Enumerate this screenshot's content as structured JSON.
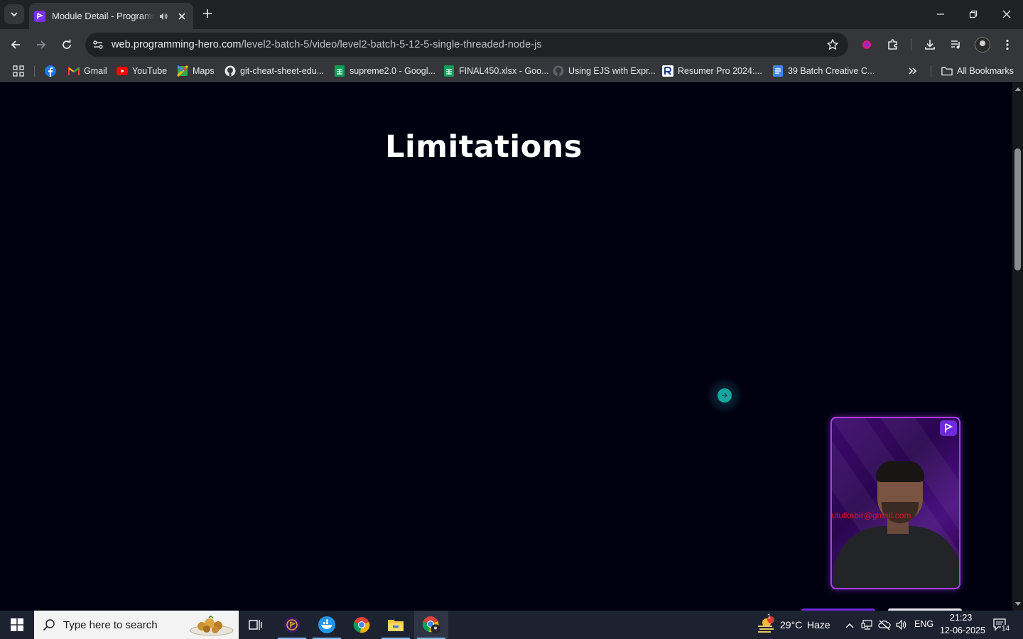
{
  "browser": {
    "tab": {
      "title": "Module Detail - Programming Hero"
    },
    "omnibox": {
      "host": "web.programming-hero.com",
      "path": "/level2-batch-5/video/level2-batch-5-12-5-single-threaded-node-js"
    },
    "bookmarks": [
      {
        "label": "",
        "icon": "facebook-icon"
      },
      {
        "label": "Gmail",
        "icon": "gmail-icon"
      },
      {
        "label": "YouTube",
        "icon": "youtube-icon"
      },
      {
        "label": "Maps",
        "icon": "maps-icon"
      },
      {
        "label": "git-cheat-sheet-edu...",
        "icon": "github-icon"
      },
      {
        "label": "supreme2.0 - Googl...",
        "icon": "sheets-icon"
      },
      {
        "label": "FINAL450.xlsx - Goo...",
        "icon": "sheets-icon"
      },
      {
        "label": "Using EJS with Expr...",
        "icon": "github-icon"
      },
      {
        "label": "Resumer Pro 2024:...",
        "icon": "resumer-icon"
      },
      {
        "label": "39 Batch Creative C...",
        "icon": "docs-icon"
      }
    ],
    "all_bookmarks_label": "All Bookmarks"
  },
  "page": {
    "slide_title": "Limitations",
    "webcam_watermark": "tutulkabir@gmail.com"
  },
  "taskbar": {
    "search_placeholder": "Type here to search",
    "weather": {
      "temp": "29°C",
      "condition": "Haze",
      "badge": "1"
    },
    "language": "ENG",
    "time": "21:23",
    "date": "12-06-2025",
    "notifications": "14"
  },
  "colors": {
    "page_bg": "#000010",
    "accent": "#b13cff",
    "chrome_bg": "#35363a"
  }
}
